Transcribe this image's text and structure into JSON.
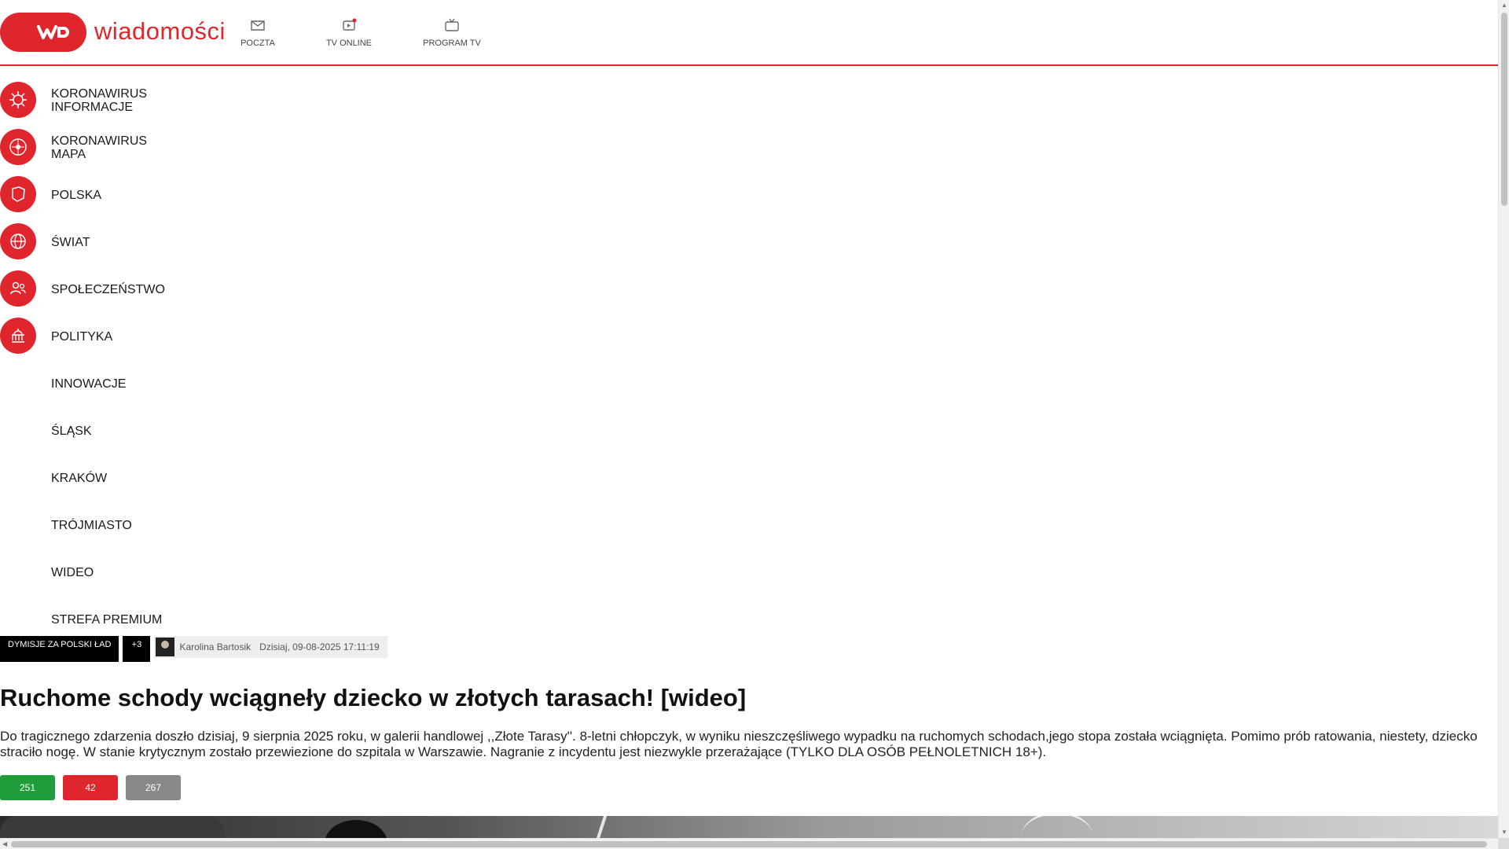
{
  "header": {
    "logo_text": "wiadomości",
    "menu_icon": "menu-icon",
    "nav": [
      {
        "label": "POCZTA",
        "icon": "mail-icon"
      },
      {
        "label": "TV ONLINE",
        "icon": "tv-online-icon"
      },
      {
        "label": "PROGRAM TV",
        "icon": "tv-program-icon"
      }
    ],
    "accent_color": "#e0262d"
  },
  "sidebar": {
    "items": [
      {
        "label": "KORONAWIRUS\nINFORMACJE",
        "icon": "virus-icon"
      },
      {
        "label": "KORONAWIRUS\nMAPA",
        "icon": "covid-map-icon"
      },
      {
        "label": "POLSKA",
        "icon": "poland-map-icon"
      },
      {
        "label": "ŚWIAT",
        "icon": "globe-icon"
      },
      {
        "label": "SPOŁECZEŃSTWO",
        "icon": "people-icon"
      },
      {
        "label": "POLITYKA",
        "icon": "parliament-icon"
      },
      {
        "label": "INNOWACJE"
      },
      {
        "label": "ŚLĄSK"
      },
      {
        "label": "KRAKÓW"
      },
      {
        "label": "TRÓJMIASTO"
      },
      {
        "label": "WIDEO"
      },
      {
        "label": "STREFA PREMIUM"
      }
    ]
  },
  "article": {
    "tag": "DYMISJE ZA POLSKI ŁAD",
    "tag_count": "+3",
    "author": "Karolina Bartosik",
    "date": "Dzisiaj, 09-08-2025 17:11:19",
    "title": "Ruchome schody wciągneły dziecko w złotych tarasach! [wideo]",
    "lead": "Do tragicznego zdarzenia doszło dzisiaj, 9 sierpnia 2025 roku, w galerii handlowej ,,Złote Tarasy''. 8-letni chłopczyk, w wyniku nieszczęśliwego wypadku na ruchomych schodach,jego stopa została wciągnięta. Pomimo prób ratowania, niestety, dziecko straciło nogę. W stanie krytycznym zostało przewiezione do szpitala w Warszawie. Nagranie z incydentu jest niezwykle przerażające (TYLKO DLA OSÓB PEŁNOLETNICH 18+).",
    "votes": {
      "up": "251",
      "down": "42",
      "share": "267"
    },
    "vote_colors": {
      "up": "#1f9d3a",
      "down": "#e0262d",
      "share": "#888888"
    }
  }
}
